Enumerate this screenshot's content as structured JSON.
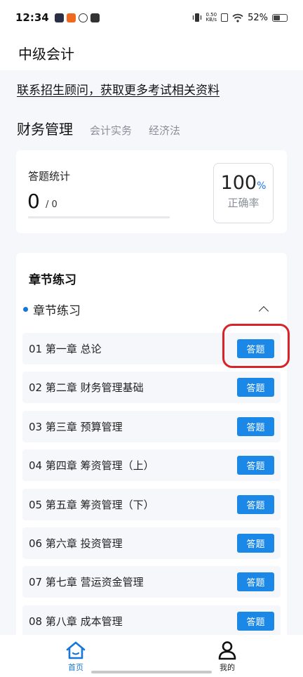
{
  "status_bar": {
    "time": "12:34",
    "net_speed_value": "0.50",
    "net_speed_unit": "KB/s",
    "battery": "52%"
  },
  "app_bar": {
    "title": "中级会计"
  },
  "notice": {
    "text": "联系招生顾问，获取更多考试相关资料"
  },
  "subject_tabs": [
    {
      "label": "财务管理",
      "active": true
    },
    {
      "label": "会计实务",
      "active": false
    },
    {
      "label": "经济法",
      "active": false
    }
  ],
  "stats": {
    "title": "答题统计",
    "answered": "0",
    "total": "/ 0",
    "rate_value": "100",
    "rate_unit": "%",
    "rate_label": "正确率",
    "progress": 0
  },
  "chapters": {
    "section_title": "章节练习",
    "group_label": "章节练习",
    "button_label": "答题",
    "items": [
      "01   第一章 总论",
      "02   第二章 财务管理基础",
      "03   第三章 预算管理",
      "04   第四章 筹资管理（上）",
      "05   第五章 筹资管理（下）",
      "06   第六章 投资管理",
      "07   第七章 营运资金管理",
      "08   第八章 成本管理"
    ]
  },
  "bottom_nav": [
    {
      "label": "首页",
      "icon": "home-icon",
      "active": true
    },
    {
      "label": "我的",
      "icon": "user-icon",
      "active": false
    }
  ],
  "colors": {
    "accent": "#1677d9",
    "button": "#1b88e8",
    "highlight": "#d8232a",
    "background": "#f5f7fb"
  }
}
